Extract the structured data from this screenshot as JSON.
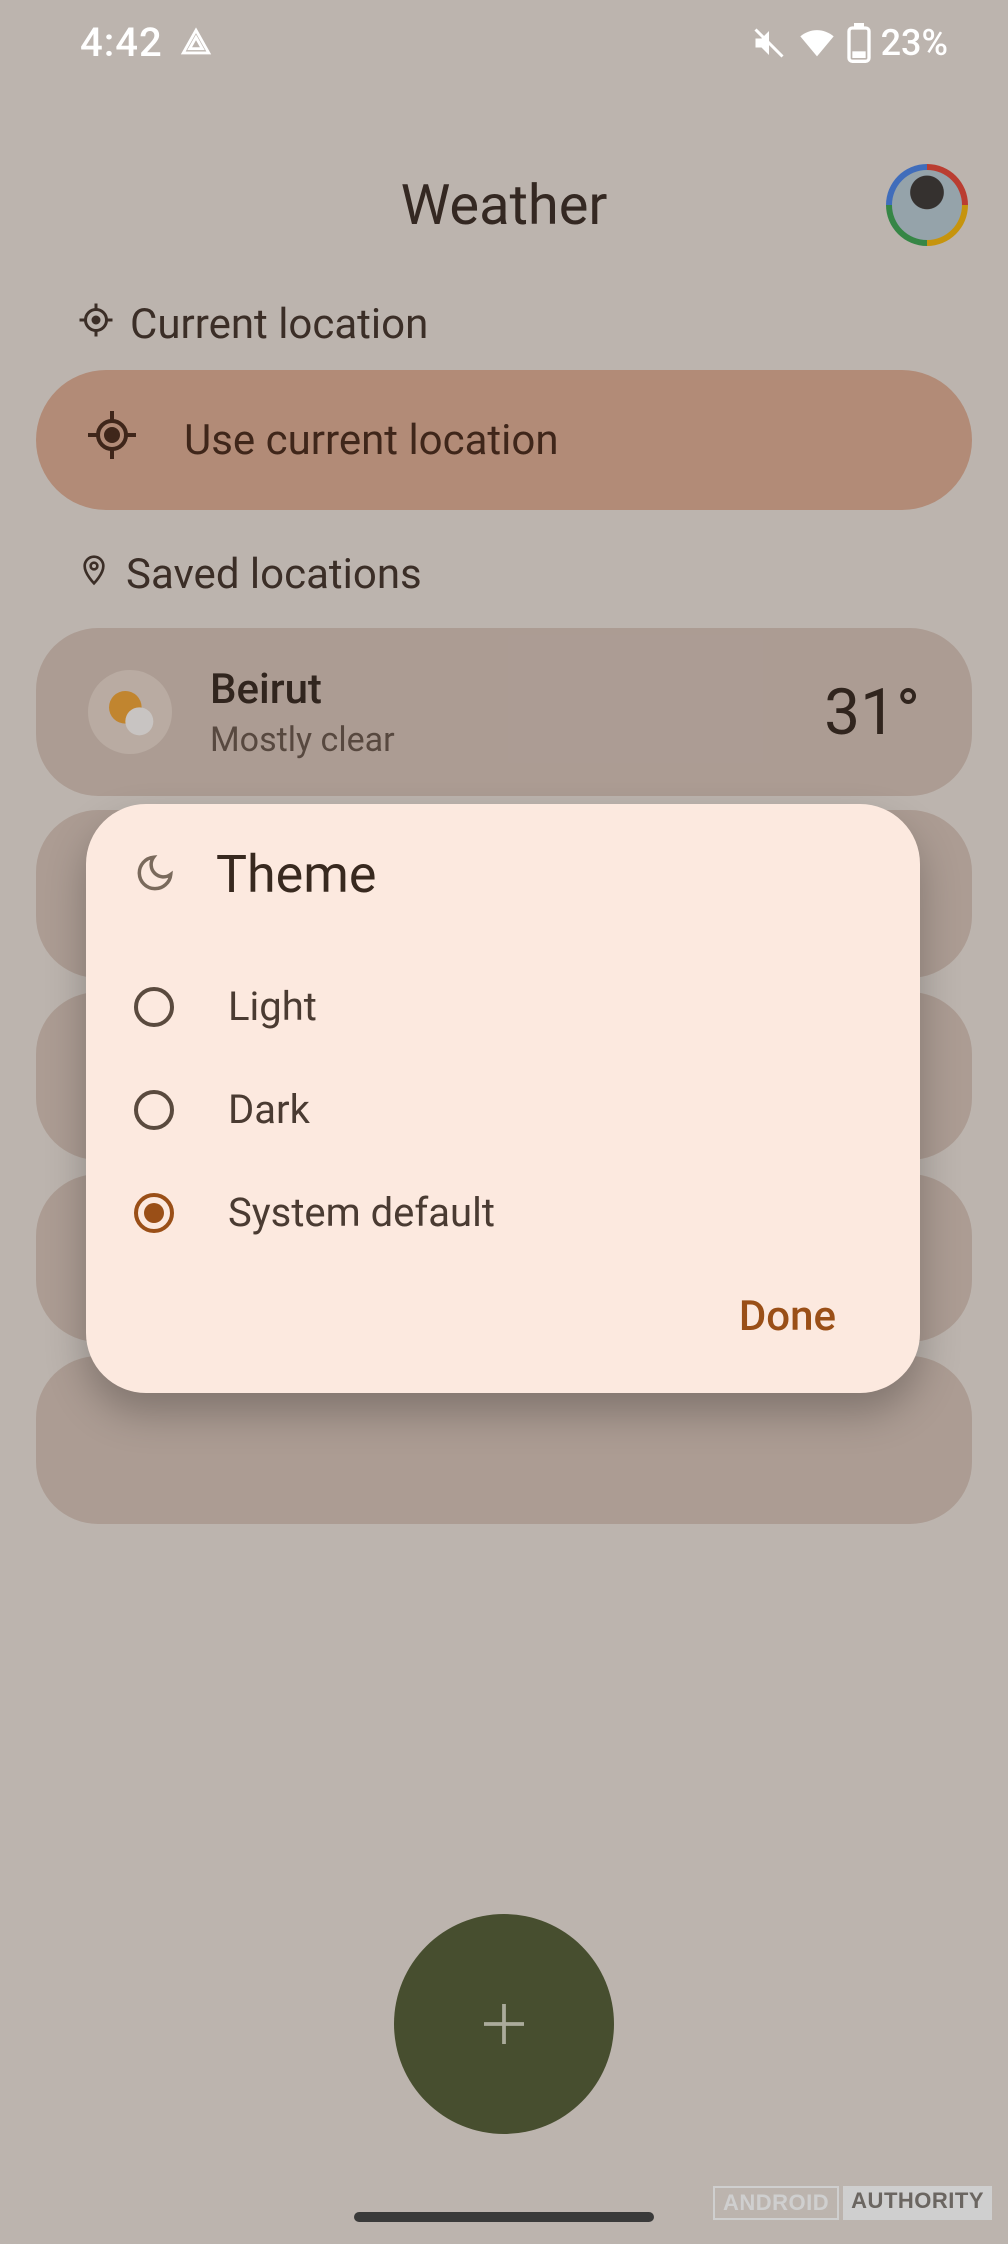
{
  "statusbar": {
    "time": "4:42",
    "battery_text": "23%"
  },
  "header": {
    "title": "Weather"
  },
  "sections": {
    "current_label": "Current location",
    "use_current_label": "Use current location",
    "saved_label": "Saved locations"
  },
  "locations": [
    {
      "city": "Beirut",
      "condition": "Mostly clear",
      "temp": "31°"
    }
  ],
  "dialog": {
    "title": "Theme",
    "options": [
      "Light",
      "Dark",
      "System default"
    ],
    "selected_index": 2,
    "done_label": "Done"
  },
  "watermark": {
    "part1": "ANDROID",
    "part2": "AUTHORITY"
  }
}
